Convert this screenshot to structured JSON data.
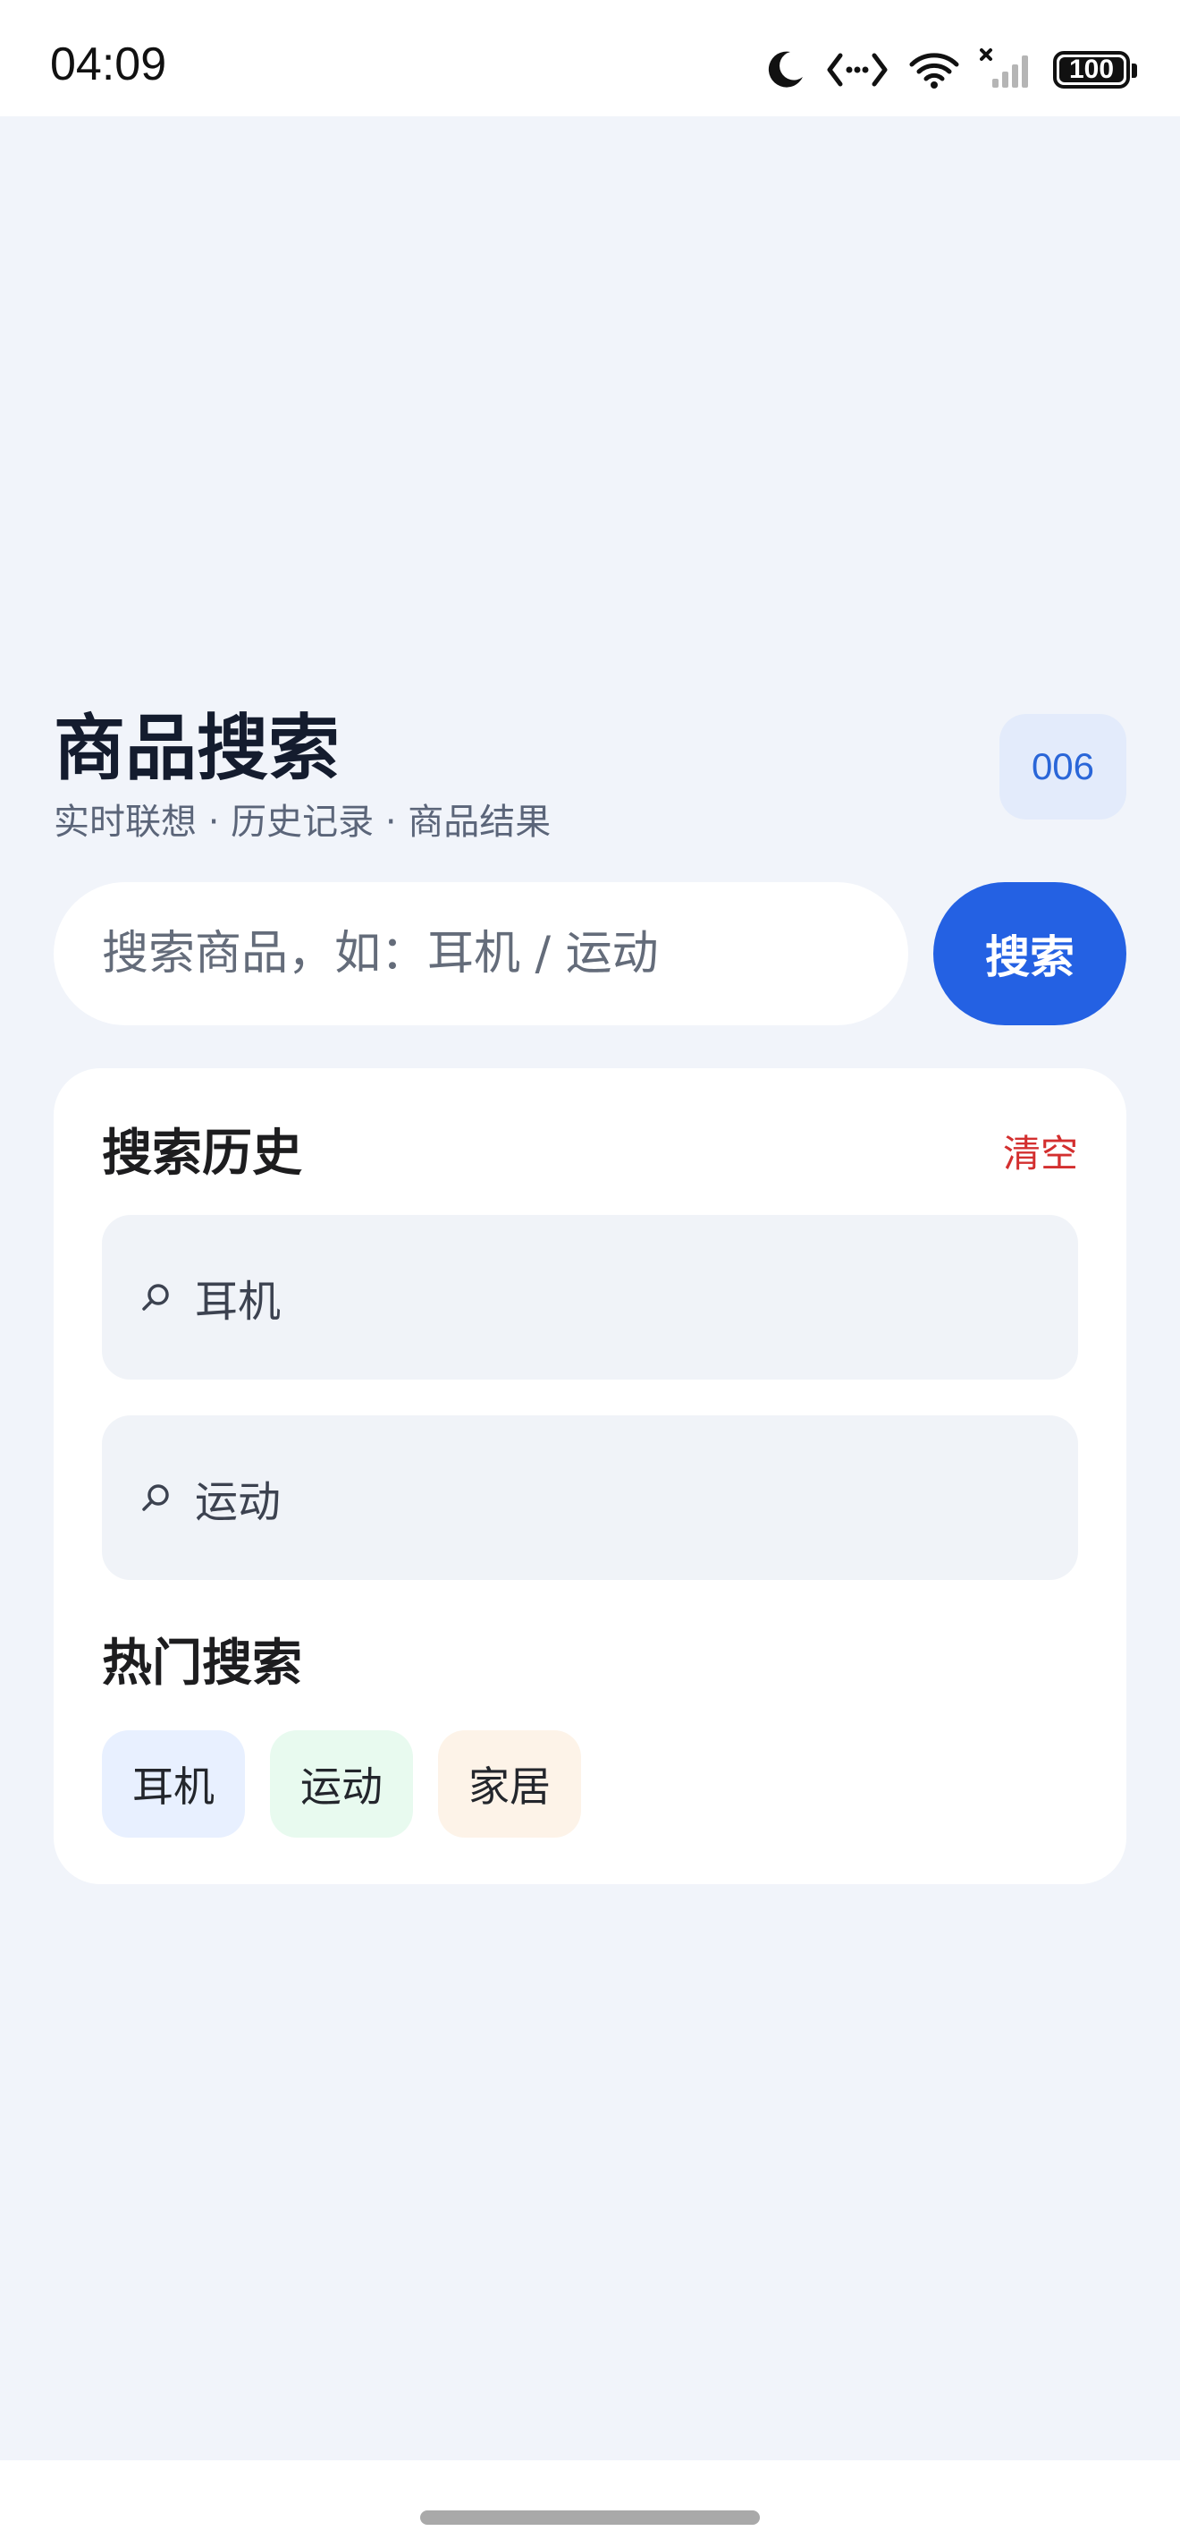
{
  "status_bar": {
    "time": "04:09",
    "battery": "100",
    "icons": [
      "moon-icon",
      "code-icon",
      "wifi-icon",
      "signal-icon",
      "battery-icon"
    ]
  },
  "header": {
    "title": "商品搜索",
    "subtitle": "实时联想 · 历史记录 · 商品结果",
    "count_badge": "006"
  },
  "search": {
    "placeholder": "搜索商品，如：耳机 / 运动",
    "value": "",
    "button_label": "搜索"
  },
  "history": {
    "title": "搜索历史",
    "clear_label": "清空",
    "items": [
      {
        "icon": "search-icon",
        "label": "耳机"
      },
      {
        "icon": "search-icon",
        "label": "运动"
      }
    ]
  },
  "hot": {
    "title": "热门搜索",
    "tags": [
      {
        "label": "耳机",
        "color": "#e8f0ff"
      },
      {
        "label": "运动",
        "color": "#e8faef"
      },
      {
        "label": "家居",
        "color": "#fdf3e8"
      }
    ]
  },
  "colors": {
    "accent": "#2461e3",
    "danger": "#d32f2f",
    "background": "#f1f4fa"
  }
}
